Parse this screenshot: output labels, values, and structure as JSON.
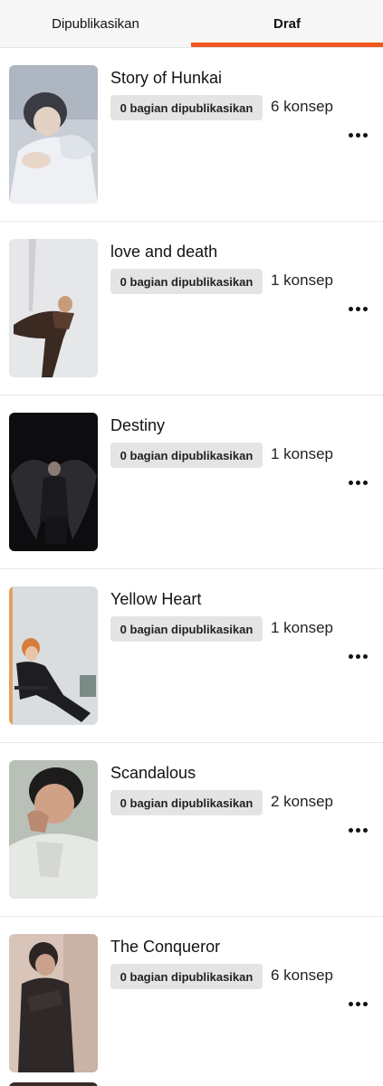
{
  "tabs": {
    "published": "Dipublikasikan",
    "drafts": "Draf"
  },
  "colors": {
    "accent": "#f0571e",
    "badge_bg": "#e4e4e4"
  },
  "stories": [
    {
      "title": "Story of Hunkai",
      "published_parts": "0 bagian dipublikasikan",
      "drafts": "6 konsep",
      "cover_icon": "cover-image"
    },
    {
      "title": "love and death",
      "published_parts": "0 bagian dipublikasikan",
      "drafts": "1 konsep",
      "cover_icon": "cover-image"
    },
    {
      "title": "Destiny",
      "published_parts": "0 bagian dipublikasikan",
      "drafts": "1 konsep",
      "cover_icon": "cover-image"
    },
    {
      "title": "Yellow Heart",
      "published_parts": "0 bagian dipublikasikan",
      "drafts": "1 konsep",
      "cover_icon": "cover-image"
    },
    {
      "title": "Scandalous",
      "published_parts": "0 bagian dipublikasikan",
      "drafts": "2 konsep",
      "cover_icon": "cover-image"
    },
    {
      "title": "The Conqueror",
      "published_parts": "0 bagian dipublikasikan",
      "drafts": "6 konsep",
      "cover_icon": "cover-image"
    }
  ],
  "more_icon": "more-horizontal-icon"
}
